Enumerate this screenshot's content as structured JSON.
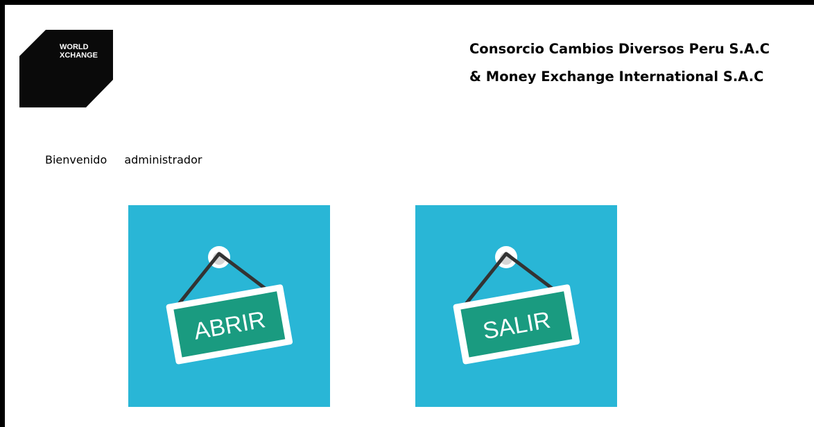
{
  "brand": {
    "logo_line1": "WORLD",
    "logo_line2": "XCHANGE",
    "logo_color": "#0a0a0a"
  },
  "header": {
    "company_line1": "Consorcio Cambios Diversos Peru S.A.C",
    "company_line2": "& Money Exchange International S.A.C"
  },
  "welcome": {
    "greeting": "Bienvenido",
    "username": "administrador"
  },
  "actions": {
    "open_label": "ABRIR",
    "exit_label": "SALIR",
    "tile_color": "#29b6d6",
    "sign_color": "#1a9b80",
    "open_icon": "hanging-sign-icon",
    "exit_icon": "hanging-sign-icon"
  }
}
